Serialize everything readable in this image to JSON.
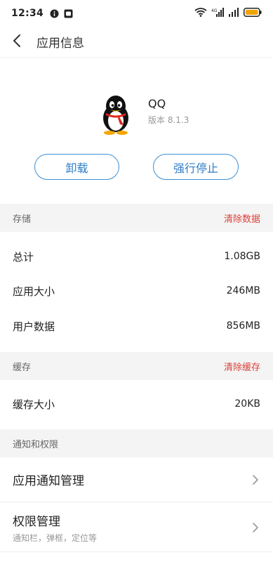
{
  "status_bar": {
    "time": "12:34",
    "icons": [
      "info-circle-icon",
      "notification-square-icon",
      "wifi-icon",
      "signal-icon",
      "signal-icon",
      "battery-icon"
    ],
    "battery_color": "#f0a400"
  },
  "header": {
    "back_icon": "chevron-left-icon",
    "title": "应用信息"
  },
  "app": {
    "name": "QQ",
    "version": "版本 8.1.3",
    "icon": "qq-penguin-icon"
  },
  "actions": {
    "uninstall": "卸载",
    "force_stop": "强行停止",
    "accent_color": "#3d8fd6"
  },
  "storage": {
    "title": "存储",
    "action": "清除数据",
    "rows": [
      {
        "label": "总计",
        "value": "1.08GB"
      },
      {
        "label": "应用大小",
        "value": "246MB"
      },
      {
        "label": "用户数据",
        "value": "856MB"
      }
    ]
  },
  "cache": {
    "title": "缓存",
    "action": "清除缓存",
    "rows": [
      {
        "label": "缓存大小",
        "value": "20KB"
      }
    ]
  },
  "notify_permissions": {
    "title": "通知和权限",
    "items": [
      {
        "title": "应用通知管理",
        "subtitle": ""
      },
      {
        "title": "权限管理",
        "subtitle": "通知栏，弹框，定位等"
      }
    ]
  },
  "colors": {
    "danger": "#d9403a",
    "section_bg": "#f4f4f4"
  }
}
